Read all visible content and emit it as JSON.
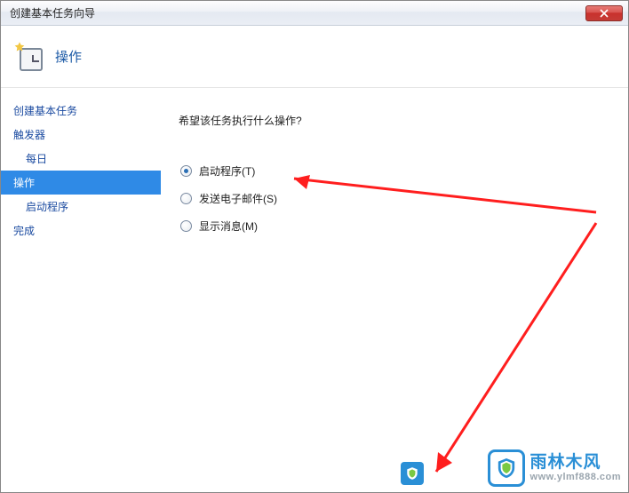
{
  "window": {
    "title": "创建基本任务向导"
  },
  "header": {
    "title": "操作"
  },
  "sidebar": {
    "items": [
      {
        "label": "创建基本任务",
        "selected": false,
        "sub": false
      },
      {
        "label": "触发器",
        "selected": false,
        "sub": false
      },
      {
        "label": "每日",
        "selected": false,
        "sub": true
      },
      {
        "label": "操作",
        "selected": true,
        "sub": false
      },
      {
        "label": "启动程序",
        "selected": false,
        "sub": true
      },
      {
        "label": "完成",
        "selected": false,
        "sub": false
      }
    ]
  },
  "content": {
    "question": "希望该任务执行什么操作?",
    "options": [
      {
        "label": "启动程序(T)",
        "checked": true
      },
      {
        "label": "发送电子邮件(S)",
        "checked": false
      },
      {
        "label": "显示消息(M)",
        "checked": false
      }
    ]
  },
  "watermark": {
    "name_cn": "雨林木风",
    "url": "www.ylmf888.com"
  }
}
